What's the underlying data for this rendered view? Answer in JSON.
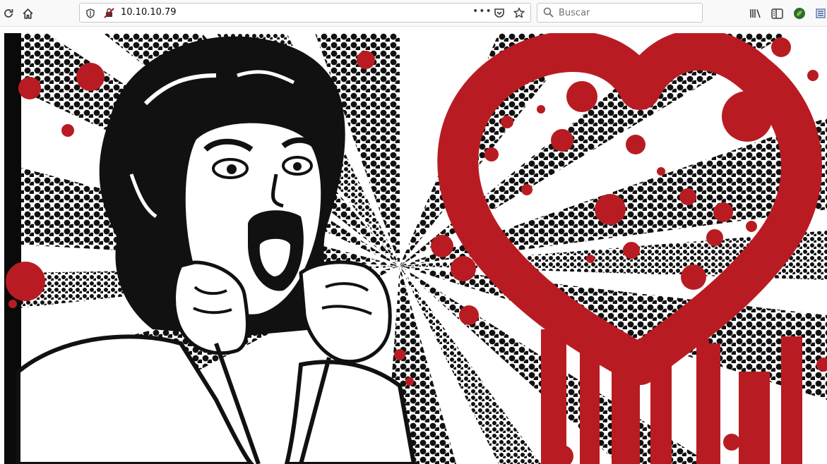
{
  "toolbar": {
    "address": "10.10.10.79",
    "search_placeholder": "Buscar"
  },
  "icons": {
    "reload": "reload-icon",
    "home": "home-icon",
    "shield": "shield-icon",
    "insecure": "insecure-connection-icon",
    "page_actions": "more-icon",
    "pocket": "pocket-icon",
    "bookmark": "star-icon",
    "search": "search-icon",
    "library": "library-icon",
    "sidebar": "sidebar-icon",
    "extension": "extension-icon",
    "menu": "menu-icon"
  },
  "colors": {
    "accent_red": "#b81c22",
    "ink": "#111111"
  },
  "page": {
    "image": "heartbleed-pop-art-banner"
  }
}
